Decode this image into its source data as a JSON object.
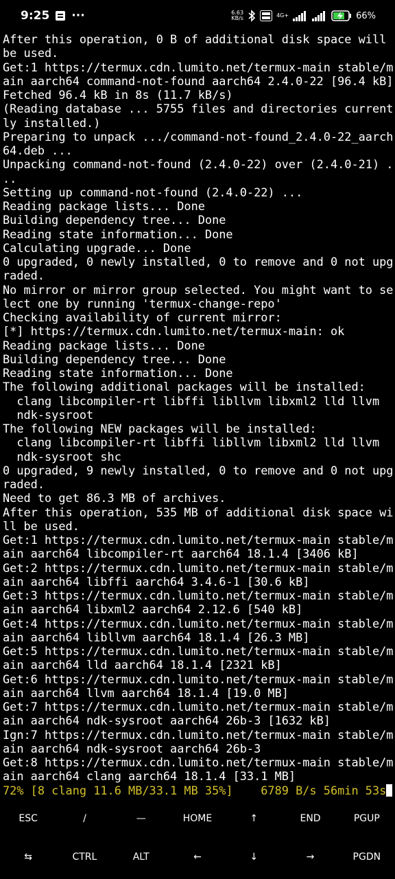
{
  "status_bar": {
    "time": "9:25",
    "notification_icon": "message-icon",
    "overflow": "···",
    "net_speed_value": "6.63",
    "net_speed_unit": "KB/s",
    "network": "4G+",
    "battery": "66%"
  },
  "terminal": {
    "lines": [
      "After this operation, 0 B of additional disk space will",
      "be used.",
      "Get:1 https://termux.cdn.lumito.net/termux-main stable/m",
      "ain aarch64 command-not-found aarch64 2.4.0-22 [96.4 kB]",
      "Fetched 96.4 kB in 8s (11.7 kB/s)",
      "(Reading database ... 5755 files and directories current",
      "ly installed.)",
      "Preparing to unpack .../command-not-found_2.4.0-22_aarch",
      "64.deb ...",
      "Unpacking command-not-found (2.4.0-22) over (2.4.0-21) .",
      "..",
      "Setting up command-not-found (2.4.0-22) ...",
      "Reading package lists... Done",
      "Building dependency tree... Done",
      "Reading state information... Done",
      "Calculating upgrade... Done",
      "0 upgraded, 0 newly installed, 0 to remove and 0 not upg",
      "raded.",
      "No mirror or mirror group selected. You might want to se",
      "lect one by running 'termux-change-repo'",
      "Checking availability of current mirror:",
      "[*] https://termux.cdn.lumito.net/termux-main: ok",
      "Reading package lists... Done",
      "Building dependency tree... Done",
      "Reading state information... Done",
      "The following additional packages will be installed:",
      "  clang libcompiler-rt libffi libllvm libxml2 lld llvm",
      "  ndk-sysroot",
      "The following NEW packages will be installed:",
      "  clang libcompiler-rt libffi libllvm libxml2 lld llvm",
      "  ndk-sysroot shc",
      "0 upgraded, 9 newly installed, 0 to remove and 0 not upg",
      "raded.",
      "Need to get 86.3 MB of archives.",
      "After this operation, 535 MB of additional disk space wi",
      "ll be used.",
      "Get:1 https://termux.cdn.lumito.net/termux-main stable/m",
      "ain aarch64 libcompiler-rt aarch64 18.1.4 [3406 kB]",
      "Get:2 https://termux.cdn.lumito.net/termux-main stable/m",
      "ain aarch64 libffi aarch64 3.4.6-1 [30.6 kB]",
      "Get:3 https://termux.cdn.lumito.net/termux-main stable/m",
      "ain aarch64 libxml2 aarch64 2.12.6 [540 kB]",
      "Get:4 https://termux.cdn.lumito.net/termux-main stable/m",
      "ain aarch64 libllvm aarch64 18.1.4 [26.3 MB]",
      "Get:5 https://termux.cdn.lumito.net/termux-main stable/m",
      "ain aarch64 lld aarch64 18.1.4 [2321 kB]",
      "Get:6 https://termux.cdn.lumito.net/termux-main stable/m",
      "ain aarch64 llvm aarch64 18.1.4 [19.0 MB]",
      "Get:7 https://termux.cdn.lumito.net/termux-main stable/m",
      "ain aarch64 ndk-sysroot aarch64 26b-3 [1632 kB]",
      "Ign:7 https://termux.cdn.lumito.net/termux-main stable/m",
      "ain aarch64 ndk-sysroot aarch64 26b-3",
      "Get:8 https://termux.cdn.lumito.net/termux-main stable/m",
      "ain aarch64 clang aarch64 18.1.4 [33.1 MB]"
    ],
    "progress_line": "72% [8 clang 11.6 MB/33.1 MB 35%]    6789 B/s 56min 53s"
  },
  "extra_keys": {
    "row1": [
      "ESC",
      "/",
      "—",
      "HOME",
      "↑",
      "END",
      "PGUP"
    ],
    "row2": [
      "⇆",
      "CTRL",
      "ALT",
      "←",
      "↓",
      "→",
      "PGDN"
    ]
  }
}
